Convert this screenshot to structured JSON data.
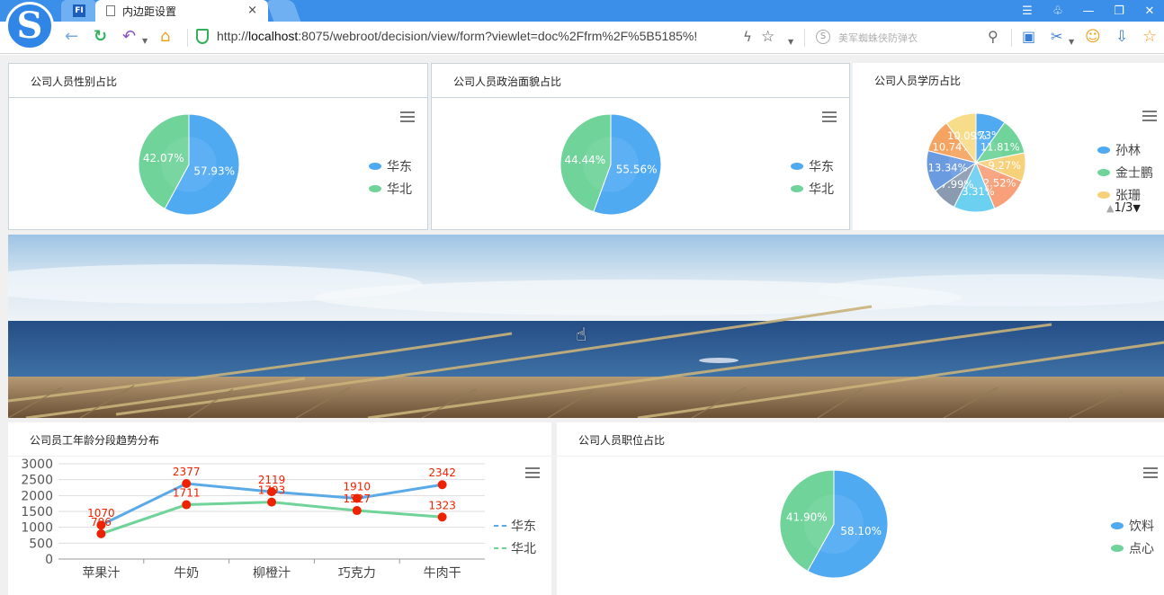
{
  "browser": {
    "tab_icon_label": "FI",
    "tab_title": "内边距设置",
    "tab_close": "×",
    "url_prefix": "http://",
    "url_host": "localhost",
    "url_rest": ":8075/webroot/decision/view/form?viewlet=doc%2Ffrm%2F%5B5185%!",
    "search_hint": "美军蜘蛛侠防弹衣",
    "search_engine_label": "S"
  },
  "panels": {
    "gender": {
      "title": "公司人员性别占比",
      "slices": [
        {
          "label": "华东",
          "percent": 57.93,
          "text": "57.93%",
          "color": "#4faaf2"
        },
        {
          "label": "华北",
          "percent": 42.07,
          "text": "42.07%",
          "color": "#6fd39a"
        }
      ]
    },
    "political": {
      "title": "公司人员政治面貌占比",
      "slices": [
        {
          "label": "华东",
          "percent": 55.56,
          "text": "55.56%",
          "color": "#4faaf2"
        },
        {
          "label": "华北",
          "percent": 44.44,
          "text": "44.44%",
          "color": "#6fd39a"
        }
      ]
    },
    "education": {
      "title": "公司人员学历占比",
      "slice_labels": [
        "9.73%",
        "11.81%",
        "9.27%",
        "12.52%",
        "13.31%",
        "7.99%",
        "13.34%",
        "10.74%",
        "10.09%"
      ],
      "slices": [
        {
          "percent": 9.73,
          "color": "#4faaf2"
        },
        {
          "percent": 11.81,
          "color": "#6fd39a"
        },
        {
          "percent": 9.27,
          "color": "#f7d07a"
        },
        {
          "percent": 12.52,
          "color": "#f7a07a"
        },
        {
          "percent": 13.31,
          "color": "#6cd0f0"
        },
        {
          "percent": 7.99,
          "color": "#8a9bb0"
        },
        {
          "percent": 13.34,
          "color": "#6a9be0"
        },
        {
          "percent": 10.74,
          "color": "#f4a460"
        },
        {
          "percent": 10.09,
          "color": "#f7dc8a"
        }
      ],
      "legend": [
        {
          "label": "孙林",
          "color": "#4faaf2"
        },
        {
          "label": "金士鹏",
          "color": "#6fd39a"
        },
        {
          "label": "张珊",
          "color": "#f7d07a"
        }
      ],
      "pager": "1/3"
    },
    "trend": {
      "title": "公司员工年龄分段趋势分布"
    },
    "position": {
      "title": "公司人员职位占比",
      "slices": [
        {
          "label": "饮料",
          "percent": 58.1,
          "text": "58.10%",
          "color": "#4faaf2"
        },
        {
          "label": "点心",
          "percent": 41.9,
          "text": "41.90%",
          "color": "#6fd39a"
        }
      ]
    }
  },
  "chart_data": [
    {
      "type": "pie",
      "title": "公司人员性别占比",
      "labels": [
        "华东",
        "华北"
      ],
      "values": [
        57.93,
        42.07
      ]
    },
    {
      "type": "pie",
      "title": "公司人员政治面貌占比",
      "labels": [
        "华东",
        "华北"
      ],
      "values": [
        55.56,
        44.44
      ]
    },
    {
      "type": "pie",
      "title": "公司人员学历占比",
      "legend_visible": [
        "孙林",
        "金士鹏",
        "张珊"
      ],
      "values": [
        9.73,
        11.81,
        9.27,
        12.52,
        13.31,
        7.99,
        13.34,
        10.74,
        10.09
      ]
    },
    {
      "type": "line",
      "title": "公司员工年龄分段趋势分布",
      "categories": [
        "苹果汁",
        "牛奶",
        "柳橙汁",
        "巧克力",
        "牛肉干"
      ],
      "ylim": [
        0,
        3000
      ],
      "yticks": [
        0,
        500,
        1000,
        1500,
        2000,
        2500,
        3000
      ],
      "series": [
        {
          "name": "华东",
          "values": [
            1070,
            2377,
            2119,
            1910,
            2342
          ],
          "color": "#5aaae8"
        },
        {
          "name": "华北",
          "values": [
            796,
            1711,
            1793,
            1527,
            1323
          ],
          "color": "#6fd39a"
        }
      ],
      "label_color": "#ee2200",
      "legend": "right"
    },
    {
      "type": "pie",
      "title": "公司人员职位占比",
      "labels": [
        "饮料",
        "点心"
      ],
      "values": [
        58.1,
        41.9
      ]
    }
  ]
}
